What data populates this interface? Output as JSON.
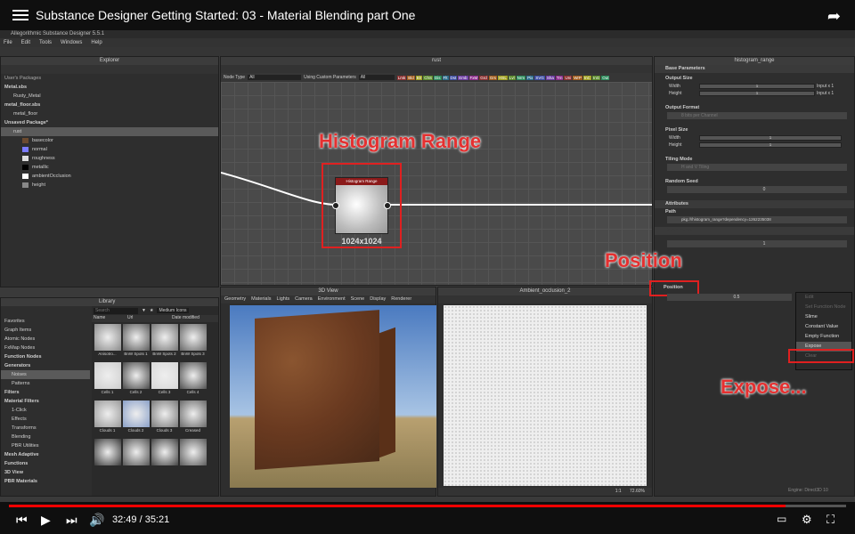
{
  "video": {
    "title": "Substance Designer Getting Started: 03 - Material Blending part One",
    "time": "32:49 / 35:21",
    "progress": 0.928
  },
  "app": {
    "title": "Allegorithmic Substance Designer 5.5.1",
    "menu": [
      "File",
      "Edit",
      "Tools",
      "Windows",
      "Help"
    ]
  },
  "explorer": {
    "header": "Explorer",
    "section": "User's Packages",
    "items": [
      {
        "label": "Metal.sbs",
        "indent": 0,
        "bold": true
      },
      {
        "label": "Rusty_Metal",
        "indent": 1
      },
      {
        "label": "metal_floor.sbs",
        "indent": 0,
        "bold": true
      },
      {
        "label": "metal_floor",
        "indent": 1
      },
      {
        "label": "Unsaved Package*",
        "indent": 0,
        "bold": true
      },
      {
        "label": "rust",
        "indent": 1,
        "selected": true
      },
      {
        "label": "basecolor",
        "indent": 2,
        "color": "#6b4a2f"
      },
      {
        "label": "normal",
        "indent": 2,
        "color": "#7b7bff"
      },
      {
        "label": "roughness",
        "indent": 2,
        "color": "#dddddd"
      },
      {
        "label": "metallic",
        "indent": 2,
        "color": "#000000"
      },
      {
        "label": "ambientOcclusion",
        "indent": 2,
        "color": "#ffffff"
      },
      {
        "label": "height",
        "indent": 2,
        "color": "#888888"
      }
    ]
  },
  "graph": {
    "header": "rust",
    "node_type_label": "Node Type",
    "node_type_value": "All",
    "using_custom": "Using Custom Parameters",
    "filter_value": "All",
    "chips": [
      "Lmk",
      "Bld",
      "Blr",
      "ChS",
      "Dis",
      "Flt",
      "Dst",
      "Emb",
      "FxM",
      "Grd",
      "Grs",
      "HSL",
      "Lvl",
      "Nrm",
      "Pix",
      "SVG",
      "Sha",
      "Trn",
      "Uni",
      "WrP",
      "InC",
      "InG",
      "Out"
    ],
    "node_title": "Histogram Range",
    "node_size": "1024x1024",
    "annotation_histogram": "Histogram Range",
    "annotation_position": "Position",
    "annotation_expose": "Expose..."
  },
  "library": {
    "header": "Library",
    "search_placeholder": "Search",
    "view_mode": "Medium Icons",
    "col_name": "Name",
    "col_url": "Url",
    "col_date": "Date modified",
    "categories": [
      {
        "label": "Favorites",
        "level": 0
      },
      {
        "label": "Graph Items",
        "level": 0
      },
      {
        "label": "Atomic Nodes",
        "level": 0
      },
      {
        "label": "FxMap Nodes",
        "level": 0
      },
      {
        "label": "Function Nodes",
        "level": 0,
        "bold": true
      },
      {
        "label": "Generators",
        "level": 0,
        "bold": true
      },
      {
        "label": "Noises",
        "level": 1,
        "selected": true
      },
      {
        "label": "Patterns",
        "level": 1
      },
      {
        "label": "Filters",
        "level": 0,
        "bold": true
      },
      {
        "label": "Material Filters",
        "level": 0,
        "bold": true
      },
      {
        "label": "1-Click",
        "level": 1
      },
      {
        "label": "Effects",
        "level": 1
      },
      {
        "label": "Transforms",
        "level": 1
      },
      {
        "label": "Blending",
        "level": 1
      },
      {
        "label": "PBR Utilities",
        "level": 1
      },
      {
        "label": "Mesh Adaptive",
        "level": 0,
        "bold": true
      },
      {
        "label": "Functions",
        "level": 0,
        "bold": true
      },
      {
        "label": "3D View",
        "level": 0,
        "bold": true
      },
      {
        "label": "PBR Materials",
        "level": 0,
        "bold": true
      }
    ],
    "thumbs": [
      {
        "label": "Anisotro...",
        "shade": "#8a8a8a"
      },
      {
        "label": "BnW Spots 1",
        "shade": "#5a5a5a"
      },
      {
        "label": "BnW Spots 2",
        "shade": "#777777"
      },
      {
        "label": "BnW Spots 3",
        "shade": "#666666"
      },
      {
        "label": "Cells 1",
        "shade": "#cfcfcf"
      },
      {
        "label": "Cells 2",
        "shade": "#4a4a4a"
      },
      {
        "label": "Cells 3",
        "shade": "#d8d8d8"
      },
      {
        "label": "Cells 4",
        "shade": "#505050"
      },
      {
        "label": "Clouds 1",
        "shade": "#9a9a9a"
      },
      {
        "label": "Clouds 2",
        "shade": "#8aa0c8"
      },
      {
        "label": "Clouds 3",
        "shade": "#7a7a7a"
      },
      {
        "label": "Creased",
        "shade": "#6a6a6a"
      },
      {
        "label": "",
        "shade": "#3a3a3a"
      },
      {
        "label": "",
        "shade": "#555555"
      },
      {
        "label": "",
        "shade": "#444444"
      },
      {
        "label": "",
        "shade": "#5a5a5a"
      }
    ]
  },
  "view3d": {
    "header": "3D View",
    "menu": [
      "Geometry",
      "Materials",
      "Lights",
      "Camera",
      "Environment",
      "Scene",
      "Display",
      "Renderer"
    ]
  },
  "view2d": {
    "header": "Ambient_occlusion_2",
    "zoom": "72.60%",
    "ratio": "1:1"
  },
  "properties": {
    "header": "histogram_range",
    "base_parameters": "Base Parameters",
    "output_size": "Output Size",
    "width_label": "Width",
    "width_value": "1",
    "width_rel": "Input x 1",
    "height_label": "Height",
    "height_value": "1",
    "height_rel": "Input x 1",
    "output_format": "Output Format",
    "output_format_value": "8 bits per Channel",
    "pixel_size": "Pixel Size",
    "px_width_value": "1",
    "px_height_value": "1",
    "tiling_mode": "Tiling Mode",
    "tiling_value": "H and V Tiling",
    "random_seed": "Random Seed",
    "seed_value": "0",
    "attributes": "Attributes",
    "path_label": "Path",
    "path_value": "pkg:///histogram_range?dependency=1262235038",
    "parameters": "Parameters",
    "range_value": "1",
    "position_label": "Position",
    "position_value": "0.5",
    "context_menu": [
      "Edit",
      "Set Function Node",
      "Slime",
      "Constant Value",
      "Empty Function",
      "Expose",
      "Clear"
    ],
    "status": "Engine: Direct3D 10"
  }
}
